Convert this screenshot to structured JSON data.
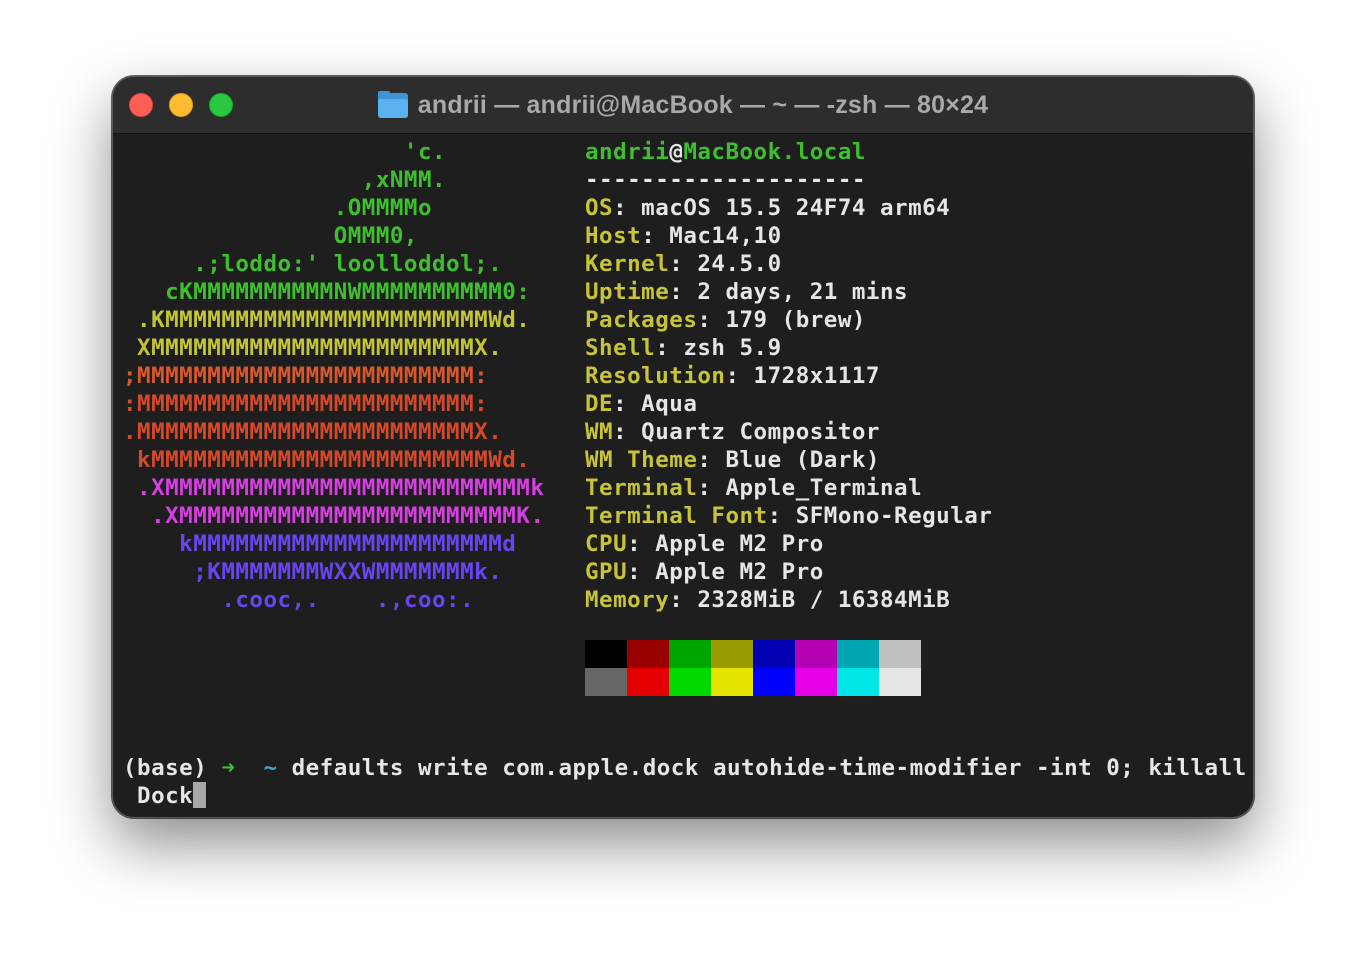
{
  "window": {
    "title": "andrii — andrii@MacBook — ~ — -zsh — 80×24"
  },
  "logo": {
    "lines": [
      {
        "text": "                    'c.",
        "color": "green"
      },
      {
        "text": "                 ,xNMM.",
        "color": "green"
      },
      {
        "text": "               .OMMMMo",
        "color": "green"
      },
      {
        "text": "               OMMM0,",
        "color": "green"
      },
      {
        "text": "     .;loddo:' loolloddol;.",
        "color": "green"
      },
      {
        "text": "   cKMMMMMMMMMMNWMMMMMMMMMM0:",
        "color": "green"
      },
      {
        "text": " .KMMMMMMMMMMMMMMMMMMMMMMMWd.",
        "color": "yellow"
      },
      {
        "text": " XMMMMMMMMMMMMMMMMMMMMMMMX.",
        "color": "yellow"
      },
      {
        "text": ";MMMMMMMMMMMMMMMMMMMMMMMM:",
        "color": "orange"
      },
      {
        "text": ":MMMMMMMMMMMMMMMMMMMMMMMM:",
        "color": "red"
      },
      {
        "text": ".MMMMMMMMMMMMMMMMMMMMMMMMX.",
        "color": "red"
      },
      {
        "text": " kMMMMMMMMMMMMMMMMMMMMMMMMWd.",
        "color": "red"
      },
      {
        "text": " .XMMMMMMMMMMMMMMMMMMMMMMMMMMk",
        "color": "magenta"
      },
      {
        "text": "  .XMMMMMMMMMMMMMMMMMMMMMMMMK.",
        "color": "magenta"
      },
      {
        "text": "    kMMMMMMMMMMMMMMMMMMMMMMd",
        "color": "violet"
      },
      {
        "text": "     ;KMMMMMMMWXXWMMMMMMMk.",
        "color": "violet"
      },
      {
        "text": "       .cooc,.    .,coo:.",
        "color": "violet"
      }
    ]
  },
  "info": {
    "user": "andrii",
    "at": "@",
    "host": "MacBook.local",
    "separator": "--------------------",
    "rows": [
      {
        "key": "OS",
        "value": ": macOS 15.5 24F74 arm64"
      },
      {
        "key": "Host",
        "value": ": Mac14,10"
      },
      {
        "key": "Kernel",
        "value": ": 24.5.0"
      },
      {
        "key": "Uptime",
        "value": ": 2 days, 21 mins"
      },
      {
        "key": "Packages",
        "value": ": 179 (brew)"
      },
      {
        "key": "Shell",
        "value": ": zsh 5.9"
      },
      {
        "key": "Resolution",
        "value": ": 1728x1117"
      },
      {
        "key": "DE",
        "value": ": Aqua"
      },
      {
        "key": "WM",
        "value": ": Quartz Compositor"
      },
      {
        "key": "WM Theme",
        "value": ": Blue (Dark)"
      },
      {
        "key": "Terminal",
        "value": ": Apple_Terminal"
      },
      {
        "key": "Terminal Font",
        "value": ": SFMono-Regular"
      },
      {
        "key": "CPU",
        "value": ": Apple M2 Pro"
      },
      {
        "key": "GPU",
        "value": ": Apple M2 Pro"
      },
      {
        "key": "Memory",
        "value": ": 2328MiB / 16384MiB"
      }
    ]
  },
  "palette": {
    "normal": [
      "#000000",
      "#990000",
      "#00a600",
      "#999900",
      "#0000b2",
      "#b200b2",
      "#00a6b2",
      "#bfbfbf"
    ],
    "bright": [
      "#666666",
      "#e50000",
      "#00d900",
      "#e5e500",
      "#0000ff",
      "#e500e5",
      "#00e5e5",
      "#e5e5e5"
    ]
  },
  "prompt": {
    "env": "(base)",
    "arrow": "➜",
    "cwd": "~",
    "command": "defaults write com.apple.dock autohide-time-modifier -int 0; killall",
    "wrap": " Dock"
  }
}
